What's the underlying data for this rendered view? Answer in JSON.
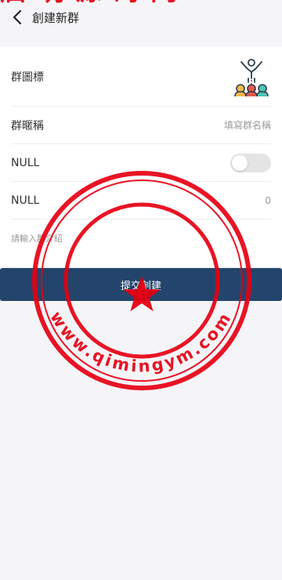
{
  "header": {
    "title": "創建新群",
    "back_icon": "chevron-left-icon"
  },
  "form": {
    "avatar": {
      "label": "群圖標",
      "icon": "group-people-icon"
    },
    "name": {
      "label": "群暱稱",
      "placeholder": "填寫群名稱",
      "value": ""
    },
    "toggle_row": {
      "label": "NULL",
      "enabled": false
    },
    "count_row": {
      "label": "NULL",
      "value": "0"
    },
    "intro": {
      "placeholder": "請輸入群介紹",
      "value": ""
    }
  },
  "submit": {
    "label": "提交創建"
  },
  "watermark": {
    "top_text": "启明源码网",
    "bottom_text": "www.qimingym.com",
    "icon": "star-icon"
  },
  "colors": {
    "primary": "#23456b",
    "background": "#f5f5f8",
    "stamp_red": "#e60012"
  }
}
